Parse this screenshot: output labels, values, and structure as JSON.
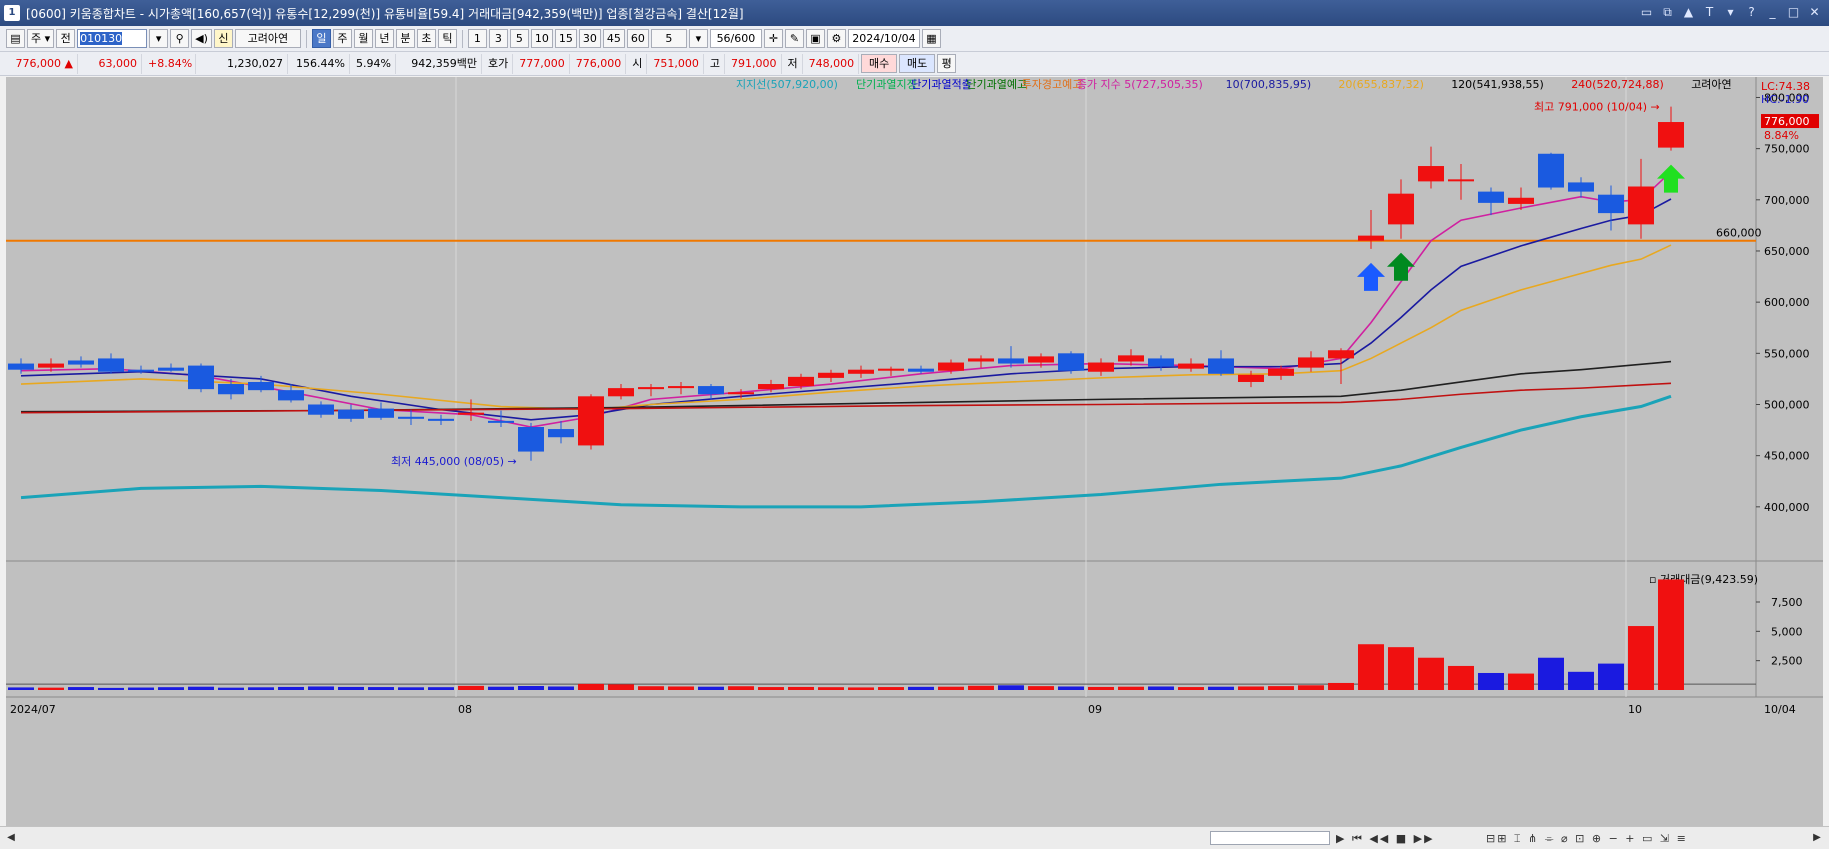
{
  "window": {
    "title": "[0600] 키움종합차트 - 시가총액[160,657(억)] 유통수[12,299(천)] 유통비율[59.4] 거래대금[942,359(백만)] 업종[철강금속] 결산[12월]",
    "app_icon": "1"
  },
  "toolbar": {
    "period_label": "주",
    "prev_label": "전",
    "code": "010130",
    "stock_badge": "신",
    "stock_name": "고려아연",
    "periods": [
      "일",
      "주",
      "월",
      "년",
      "분",
      "초",
      "틱"
    ],
    "selected_period": "일",
    "intervals": [
      "1",
      "3",
      "5",
      "10",
      "15",
      "30",
      "45",
      "60"
    ],
    "interval_value": "5",
    "count_display": "56/600",
    "date": "2024/10/04"
  },
  "quote": {
    "price": "776,000",
    "change": "63,000",
    "change_pct": "+8.84%",
    "volume": "1,230,027",
    "volume_ratio": "156.44%",
    "turnover": "5.94%",
    "amount": "942,359백만",
    "ask_label": "호가",
    "ask1": "777,000",
    "ask2": "776,000",
    "open_label": "시",
    "open": "751,000",
    "high_label": "고",
    "high": "791,000",
    "low_label": "저",
    "low": "748,000",
    "buy_label": "매수",
    "sell_label": "매도",
    "avg_label": "평"
  },
  "legend": {
    "items": [
      {
        "text": "지지선(507,920,00)",
        "color": "#1aa3b8"
      },
      {
        "text": "단기과열지정",
        "color": "#00b050"
      },
      {
        "text": "단기과열적출",
        "color": "#0000cc"
      },
      {
        "text": "단기과열예고",
        "color": "#007000"
      },
      {
        "text": "투자경고예고",
        "color": "#e0701a"
      },
      {
        "text": "종가 지수 5(727,505,35)",
        "color": "#d020a0"
      },
      {
        "text": "10(700,835,95)",
        "color": "#1a1aa0"
      },
      {
        "text": "20(655,837,32)",
        "color": "#e8a820"
      },
      {
        "text": "120(541,938,55)",
        "color": "#000000"
      },
      {
        "text": "240(520,724,88)",
        "color": "#e00000"
      },
      {
        "text": "고려아연",
        "color": "#000000"
      }
    ]
  },
  "chart_data": {
    "type": "candlestick",
    "price_axis": {
      "ticks": [
        400000,
        450000,
        500000,
        550000,
        600000,
        650000,
        700000,
        750000,
        800000
      ],
      "tick_labels": [
        "400,000",
        "450,000",
        "500,000",
        "550,000",
        "600,000",
        "650,000",
        "700,000",
        "750,000",
        "800,000"
      ],
      "range": [
        350000,
        820000
      ]
    },
    "lc_label": "LC:74.38",
    "hc_label": "HC:-1.90",
    "current_price_label": "776,000",
    "current_pct_label": "8.84%",
    "horizontal_line": {
      "value": 660000,
      "label": "660,000",
      "color": "#f07800"
    },
    "max_annotation": "최고 791,000 (10/04)",
    "min_annotation": "최저 445,000 (08/05)",
    "x_labels": [
      {
        "index": 0,
        "text": "2024/07"
      },
      {
        "index": 15,
        "text": "08"
      },
      {
        "index": 36,
        "text": "09"
      },
      {
        "index": 54,
        "text": "10"
      },
      {
        "index": 58,
        "text": "10/04"
      }
    ],
    "candles": [
      {
        "o": 540000,
        "h": 545000,
        "l": 530000,
        "c": 534000
      },
      {
        "o": 536000,
        "h": 545000,
        "l": 532000,
        "c": 540000
      },
      {
        "o": 543000,
        "h": 547000,
        "l": 536000,
        "c": 539000
      },
      {
        "o": 545000,
        "h": 550000,
        "l": 530000,
        "c": 532000
      },
      {
        "o": 534000,
        "h": 538000,
        "l": 530000,
        "c": 533000
      },
      {
        "o": 536000,
        "h": 540000,
        "l": 532000,
        "c": 533000
      },
      {
        "o": 538000,
        "h": 540000,
        "l": 512000,
        "c": 515000
      },
      {
        "o": 520000,
        "h": 525000,
        "l": 505000,
        "c": 510000
      },
      {
        "o": 522000,
        "h": 528000,
        "l": 512000,
        "c": 514000
      },
      {
        "o": 514000,
        "h": 520000,
        "l": 502000,
        "c": 504000
      },
      {
        "o": 500000,
        "h": 503000,
        "l": 487000,
        "c": 490000
      },
      {
        "o": 495000,
        "h": 500000,
        "l": 483000,
        "c": 486000
      },
      {
        "o": 496000,
        "h": 502000,
        "l": 485000,
        "c": 487000
      },
      {
        "o": 488000,
        "h": 495000,
        "l": 480000,
        "c": 486000
      },
      {
        "o": 486000,
        "h": 490000,
        "l": 480000,
        "c": 484000
      },
      {
        "o": 490000,
        "h": 505000,
        "l": 484000,
        "c": 492000
      },
      {
        "o": 484000,
        "h": 494000,
        "l": 478000,
        "c": 483000
      },
      {
        "o": 478000,
        "h": 482000,
        "l": 445000,
        "c": 454000
      },
      {
        "o": 476000,
        "h": 484000,
        "l": 462000,
        "c": 468000
      },
      {
        "o": 460000,
        "h": 510000,
        "l": 456000,
        "c": 508000
      },
      {
        "o": 508000,
        "h": 520000,
        "l": 505000,
        "c": 516000
      },
      {
        "o": 515000,
        "h": 520000,
        "l": 508000,
        "c": 517000
      },
      {
        "o": 516000,
        "h": 522000,
        "l": 510000,
        "c": 518000
      },
      {
        "o": 518000,
        "h": 520000,
        "l": 505000,
        "c": 510000
      },
      {
        "o": 510000,
        "h": 515000,
        "l": 506000,
        "c": 512000
      },
      {
        "o": 515000,
        "h": 524000,
        "l": 512000,
        "c": 520000
      },
      {
        "o": 518000,
        "h": 530000,
        "l": 515000,
        "c": 527000
      },
      {
        "o": 526000,
        "h": 534000,
        "l": 522000,
        "c": 531000
      },
      {
        "o": 530000,
        "h": 538000,
        "l": 526000,
        "c": 534000
      },
      {
        "o": 533000,
        "h": 537000,
        "l": 528000,
        "c": 535000
      },
      {
        "o": 535000,
        "h": 538000,
        "l": 530000,
        "c": 532000
      },
      {
        "o": 533000,
        "h": 544000,
        "l": 530000,
        "c": 541000
      },
      {
        "o": 542000,
        "h": 548000,
        "l": 536000,
        "c": 545000
      },
      {
        "o": 545000,
        "h": 557000,
        "l": 536000,
        "c": 540000
      },
      {
        "o": 541000,
        "h": 550000,
        "l": 536000,
        "c": 547000
      },
      {
        "o": 550000,
        "h": 552000,
        "l": 530000,
        "c": 533000
      },
      {
        "o": 532000,
        "h": 545000,
        "l": 528000,
        "c": 541000
      },
      {
        "o": 542000,
        "h": 554000,
        "l": 538000,
        "c": 548000
      },
      {
        "o": 545000,
        "h": 548000,
        "l": 533000,
        "c": 537000
      },
      {
        "o": 535000,
        "h": 545000,
        "l": 532000,
        "c": 540000
      },
      {
        "o": 545000,
        "h": 553000,
        "l": 528000,
        "c": 530000
      },
      {
        "o": 522000,
        "h": 533000,
        "l": 517000,
        "c": 529000
      },
      {
        "o": 528000,
        "h": 538000,
        "l": 524000,
        "c": 535000
      },
      {
        "o": 536000,
        "h": 552000,
        "l": 532000,
        "c": 546000
      },
      {
        "o": 545000,
        "h": 555000,
        "l": 520000,
        "c": 553000
      },
      {
        "o": 660000,
        "h": 690000,
        "l": 652000,
        "c": 665000
      },
      {
        "o": 676000,
        "h": 720000,
        "l": 662000,
        "c": 706000
      },
      {
        "o": 718000,
        "h": 752000,
        "l": 711000,
        "c": 733000
      },
      {
        "o": 720000,
        "h": 735000,
        "l": 700000,
        "c": 720000
      },
      {
        "o": 708000,
        "h": 712000,
        "l": 685000,
        "c": 697000
      },
      {
        "o": 696000,
        "h": 712000,
        "l": 690000,
        "c": 702000
      },
      {
        "o": 745000,
        "h": 746000,
        "l": 710000,
        "c": 712000
      },
      {
        "o": 717000,
        "h": 722000,
        "l": 702000,
        "c": 708000
      },
      {
        "o": 705000,
        "h": 714000,
        "l": 670000,
        "c": 687000
      },
      {
        "o": 676000,
        "h": 740000,
        "l": 662000,
        "c": 713000
      },
      {
        "o": 751000,
        "h": 791000,
        "l": 748000,
        "c": 776000
      }
    ],
    "moving_averages": [
      {
        "name": "5",
        "color": "#d020a0",
        "points": [
          [
            0,
            533000
          ],
          [
            3,
            535000
          ],
          [
            6,
            528000
          ],
          [
            9,
            512000
          ],
          [
            12,
            495000
          ],
          [
            15,
            490000
          ],
          [
            17,
            478000
          ],
          [
            19,
            488000
          ],
          [
            21,
            505000
          ],
          [
            24,
            512000
          ],
          [
            27,
            520000
          ],
          [
            30,
            530000
          ],
          [
            33,
            538000
          ],
          [
            36,
            540000
          ],
          [
            39,
            538000
          ],
          [
            42,
            535000
          ],
          [
            44,
            545000
          ],
          [
            45,
            580000
          ],
          [
            46,
            620000
          ],
          [
            47,
            660000
          ],
          [
            48,
            680000
          ],
          [
            50,
            692000
          ],
          [
            52,
            703000
          ],
          [
            53,
            698000
          ],
          [
            54,
            700000
          ],
          [
            55,
            727500
          ]
        ]
      },
      {
        "name": "10",
        "color": "#1a1aa0",
        "points": [
          [
            0,
            528000
          ],
          [
            4,
            532000
          ],
          [
            8,
            525000
          ],
          [
            11,
            508000
          ],
          [
            14,
            495000
          ],
          [
            17,
            485000
          ],
          [
            19,
            490000
          ],
          [
            21,
            500000
          ],
          [
            24,
            508000
          ],
          [
            27,
            515000
          ],
          [
            30,
            522000
          ],
          [
            33,
            530000
          ],
          [
            36,
            535000
          ],
          [
            39,
            537000
          ],
          [
            42,
            537000
          ],
          [
            44,
            540000
          ],
          [
            45,
            560000
          ],
          [
            46,
            585000
          ],
          [
            47,
            612000
          ],
          [
            48,
            635000
          ],
          [
            50,
            655000
          ],
          [
            52,
            672000
          ],
          [
            53,
            680000
          ],
          [
            54,
            685000
          ],
          [
            55,
            700800
          ]
        ]
      },
      {
        "name": "20",
        "color": "#e8a820",
        "points": [
          [
            0,
            520000
          ],
          [
            4,
            525000
          ],
          [
            8,
            520000
          ],
          [
            12,
            510000
          ],
          [
            16,
            498000
          ],
          [
            19,
            495000
          ],
          [
            21,
            500000
          ],
          [
            24,
            505000
          ],
          [
            27,
            512000
          ],
          [
            30,
            518000
          ],
          [
            33,
            522000
          ],
          [
            36,
            526000
          ],
          [
            39,
            529000
          ],
          [
            42,
            530000
          ],
          [
            44,
            533000
          ],
          [
            45,
            545000
          ],
          [
            46,
            560000
          ],
          [
            47,
            575000
          ],
          [
            48,
            592000
          ],
          [
            50,
            612000
          ],
          [
            52,
            628000
          ],
          [
            53,
            636000
          ],
          [
            54,
            642000
          ],
          [
            55,
            655800
          ]
        ]
      },
      {
        "name": "120",
        "color": "#202020",
        "points": [
          [
            0,
            493000
          ],
          [
            10,
            494000
          ],
          [
            20,
            497000
          ],
          [
            30,
            502000
          ],
          [
            36,
            505000
          ],
          [
            44,
            508000
          ],
          [
            46,
            514000
          ],
          [
            48,
            522000
          ],
          [
            50,
            530000
          ],
          [
            52,
            534000
          ],
          [
            55,
            541900
          ]
        ]
      },
      {
        "name": "240",
        "color": "#c01010",
        "points": [
          [
            0,
            492000
          ],
          [
            10,
            494000
          ],
          [
            20,
            496000
          ],
          [
            30,
            499000
          ],
          [
            36,
            500000
          ],
          [
            44,
            502000
          ],
          [
            46,
            505000
          ],
          [
            48,
            510000
          ],
          [
            50,
            514000
          ],
          [
            52,
            516000
          ],
          [
            55,
            520700
          ]
        ]
      },
      {
        "name": "지지선",
        "color": "#1aa3b8",
        "points": [
          [
            0,
            409000
          ],
          [
            4,
            418000
          ],
          [
            8,
            420000
          ],
          [
            12,
            416000
          ],
          [
            16,
            409000
          ],
          [
            20,
            402000
          ],
          [
            24,
            400000
          ],
          [
            28,
            400000
          ],
          [
            32,
            405000
          ],
          [
            36,
            412000
          ],
          [
            40,
            422000
          ],
          [
            44,
            428000
          ],
          [
            46,
            440000
          ],
          [
            48,
            458000
          ],
          [
            50,
            475000
          ],
          [
            52,
            488000
          ],
          [
            54,
            498000
          ],
          [
            55,
            508000
          ]
        ]
      }
    ],
    "signals": [
      {
        "index": 45,
        "type": "up",
        "color": "#1a5aff"
      },
      {
        "index": 46,
        "type": "up",
        "color": "#008a20"
      },
      {
        "index": 55,
        "type": "up",
        "color": "#20e020"
      }
    ],
    "volume_panel": {
      "title": "거래대금(9,423.59)",
      "ticks": [
        2500,
        5000,
        7500
      ],
      "tick_labels": [
        "2,500",
        "5,000",
        "7,500"
      ],
      "range": [
        0,
        9800
      ],
      "volumes": [
        220,
        200,
        250,
        180,
        210,
        240,
        280,
        200,
        230,
        260,
        300,
        260,
        250,
        230,
        240,
        350,
        280,
        340,
        300,
        520,
        480,
        320,
        300,
        280,
        320,
        250,
        260,
        240,
        220,
        250,
        270,
        280,
        360,
        400,
        330,
        300,
        260,
        280,
        300,
        250,
        280,
        300,
        330,
        400,
        600,
        3900,
        3650,
        2750,
        2050,
        1450,
        1400,
        2750,
        1550,
        2250,
        5450,
        9423
      ]
    }
  }
}
